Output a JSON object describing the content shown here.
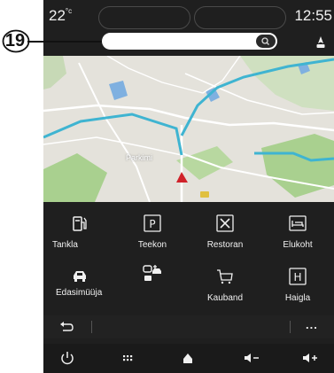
{
  "callout": {
    "number": "19"
  },
  "status_bar": {
    "temperature": "22",
    "temperature_unit": "°c",
    "time": "12:55"
  },
  "map": {
    "place_label": "Parkimi"
  },
  "poi_categories": [
    {
      "label": "Tankla",
      "icon": "fuel-icon"
    },
    {
      "label": "Teekon",
      "icon": "parking-icon"
    },
    {
      "label": "Restoran",
      "icon": "restaurant-icon"
    },
    {
      "label": "Elukoht",
      "icon": "hotel-icon"
    },
    {
      "label": "Edasimüüja",
      "icon": "car-dealer-icon"
    },
    {
      "label": "",
      "icon": "car-service-icon"
    },
    {
      "label": "Kauband",
      "icon": "shopping-cart-icon"
    },
    {
      "label": "Haigla",
      "icon": "hospital-icon"
    }
  ],
  "toolbar": {
    "back_icon": "back-arrow-icon",
    "more_icon": "more-options-icon",
    "more_label": "..."
  },
  "bottom_bar": {
    "items": [
      "power-icon",
      "apps-grid-icon",
      "home-icon",
      "volume-down-icon",
      "volume-up-icon"
    ]
  },
  "colors": {
    "route": "#3fb4d1",
    "water": "#7fb0e0",
    "park": "#a9d08f",
    "road": "#ffffff",
    "background": "#1f1f1f",
    "position_marker": "#d0222a"
  }
}
